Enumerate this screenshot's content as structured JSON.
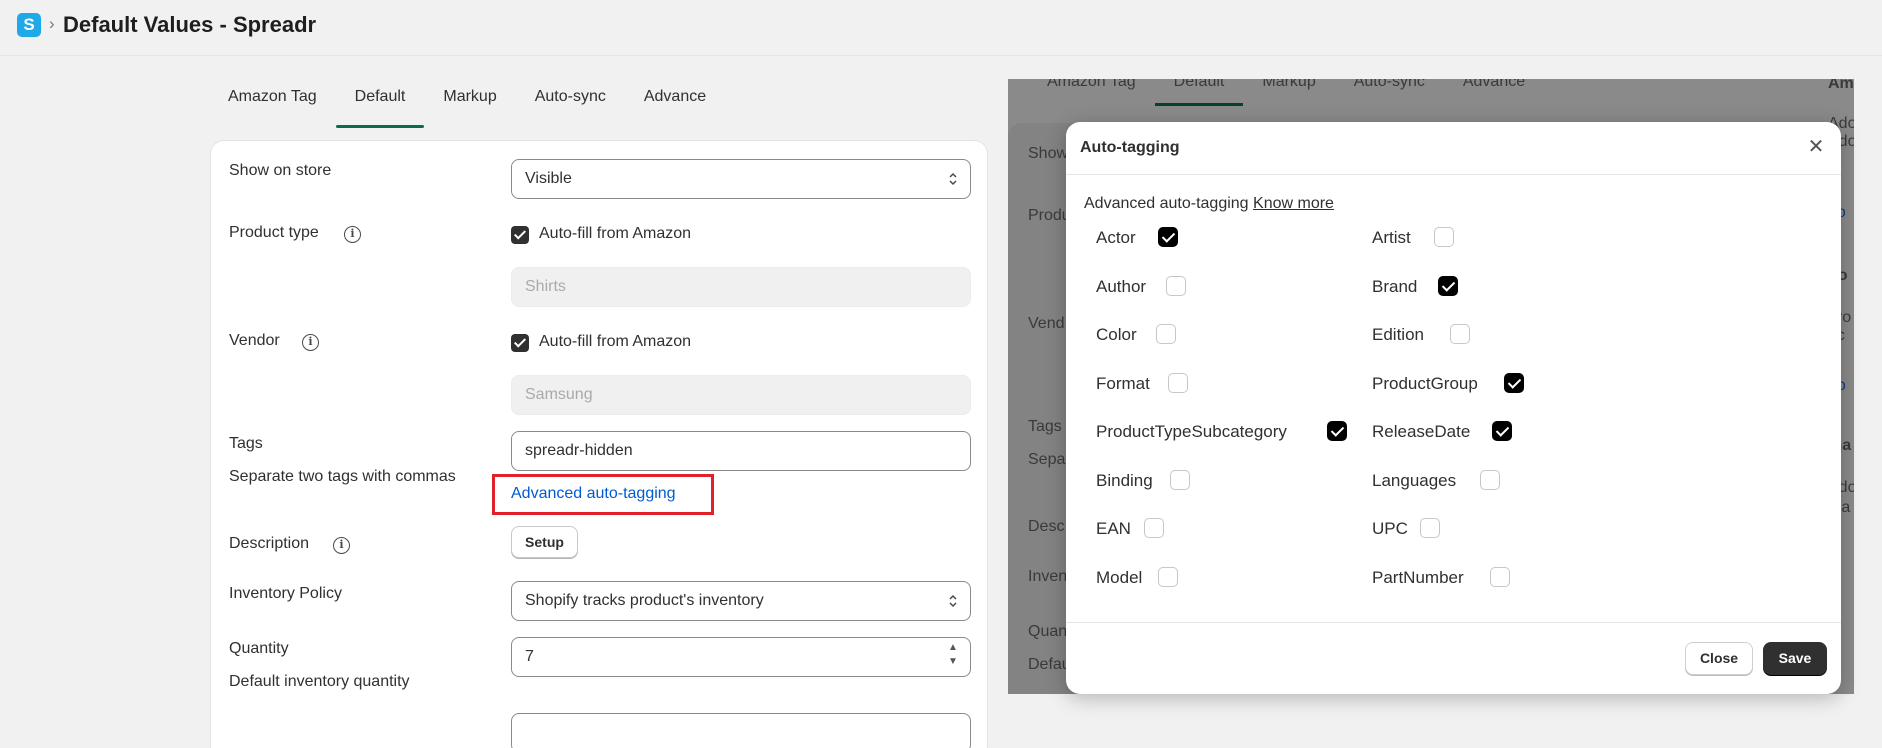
{
  "header": {
    "logo_letter": "S",
    "separator": "›",
    "title": "Default Values - Spreadr"
  },
  "tabs": [
    "Amazon Tag",
    "Default",
    "Markup",
    "Auto-sync",
    "Advance"
  ],
  "form": {
    "show_on_store_label": "Show on store",
    "show_on_store_value": "Visible",
    "product_type_label": "Product type",
    "autofill_label": "Auto-fill from Amazon",
    "product_type_placeholder": "Shirts",
    "vendor_label": "Vendor",
    "vendor_placeholder": "Samsung",
    "tags_label": "Tags",
    "tags_help": "Separate two tags with commas",
    "tags_value": "spreadr-hidden",
    "advanced_link": "Advanced auto-tagging",
    "description_label": "Description",
    "setup_button": "Setup",
    "inventory_label": "Inventory Policy",
    "inventory_value": "Shopify tracks product's inventory",
    "quantity_label": "Quantity",
    "quantity_value": "7",
    "quantity_help": "Default inventory quantity"
  },
  "overlay_bg": {
    "labels": [
      "Show",
      "Produ",
      "Vend",
      "Tags",
      "Sepa",
      "Desc",
      "Inven",
      "Quan",
      "Defau"
    ],
    "side_fragments": [
      "Am",
      "Ado",
      "Ado",
      "ie",
      "no",
      "no",
      "pro",
      "nc",
      "no",
      "ma",
      "Ado",
      "ma",
      "pl"
    ]
  },
  "modal": {
    "title": "Auto-tagging",
    "intro": "Advanced auto-tagging",
    "know_more": "Know more",
    "left_options": [
      {
        "label": "Actor",
        "checked": true
      },
      {
        "label": "Author",
        "checked": false
      },
      {
        "label": "Color",
        "checked": false
      },
      {
        "label": "Format",
        "checked": false
      },
      {
        "label": "ProductTypeSubcategory",
        "checked": true
      },
      {
        "label": "Binding",
        "checked": false
      },
      {
        "label": "EAN",
        "checked": false
      },
      {
        "label": "Model",
        "checked": false
      }
    ],
    "right_options": [
      {
        "label": "Artist",
        "checked": false
      },
      {
        "label": "Brand",
        "checked": true
      },
      {
        "label": "Edition",
        "checked": false
      },
      {
        "label": "ProductGroup",
        "checked": true
      },
      {
        "label": "ReleaseDate",
        "checked": true
      },
      {
        "label": "Languages",
        "checked": false
      },
      {
        "label": "UPC",
        "checked": false
      },
      {
        "label": "PartNumber",
        "checked": false
      }
    ],
    "close_button": "Close",
    "save_button": "Save"
  }
}
